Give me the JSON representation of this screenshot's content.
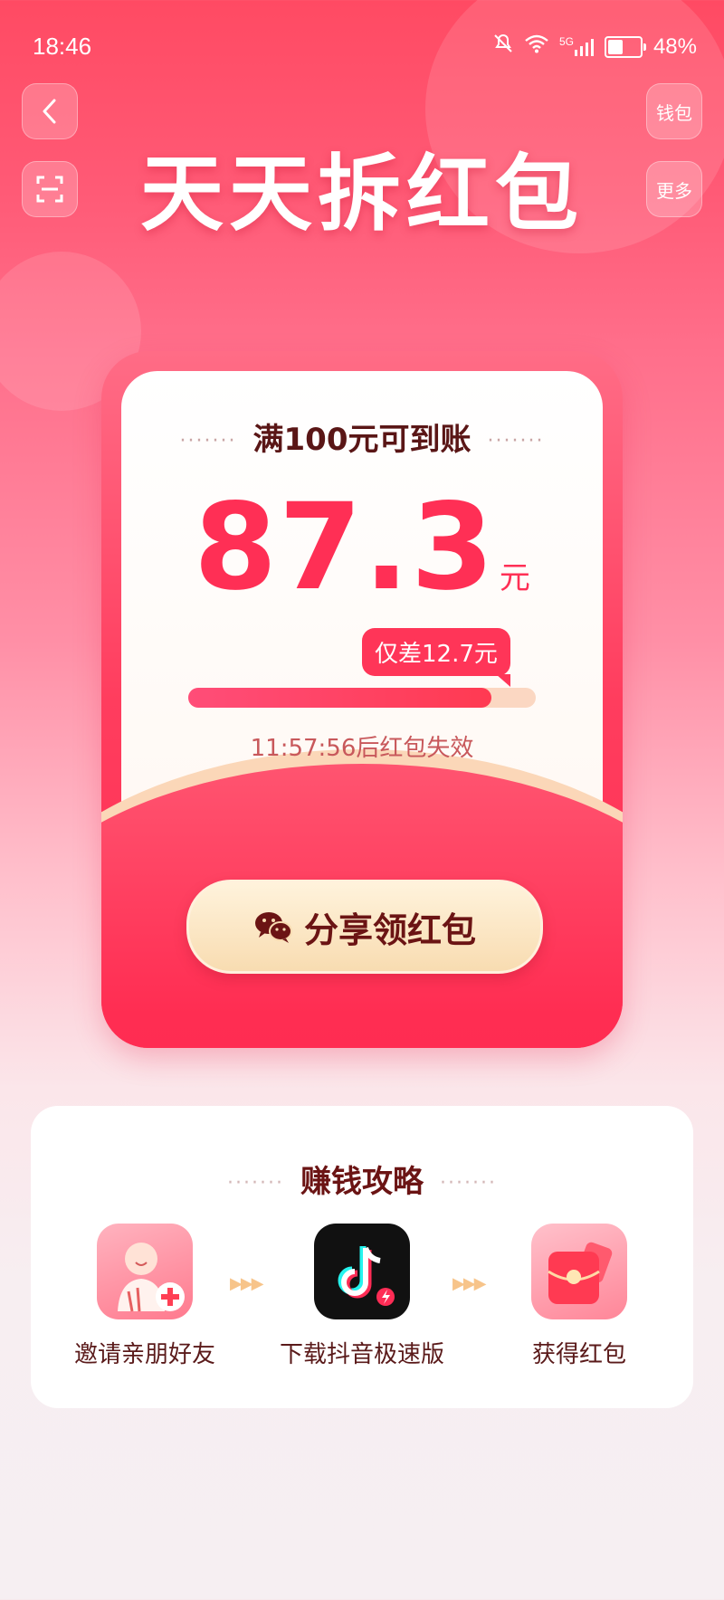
{
  "status_bar": {
    "time": "18:46",
    "network": "5G",
    "battery_percent": "48%"
  },
  "header": {
    "title": "天天拆红包",
    "wallet_label": "钱包",
    "more_label": "更多"
  },
  "card": {
    "headline": "满100元可到账",
    "amount": "87.3",
    "amount_unit": "元",
    "gap_badge": "仅差12.7元",
    "progress_fraction": 0.873,
    "expire_text": "11:57:56后红包失效",
    "share_button_label": "分享领红包"
  },
  "strategy": {
    "title": "赚钱攻略",
    "steps": [
      {
        "label": "邀请亲朋好友"
      },
      {
        "label": "下载抖音极速版"
      },
      {
        "label": "获得红包"
      }
    ]
  },
  "colors": {
    "accent": "#ff2f55",
    "brand_dark": "#6b1414"
  }
}
